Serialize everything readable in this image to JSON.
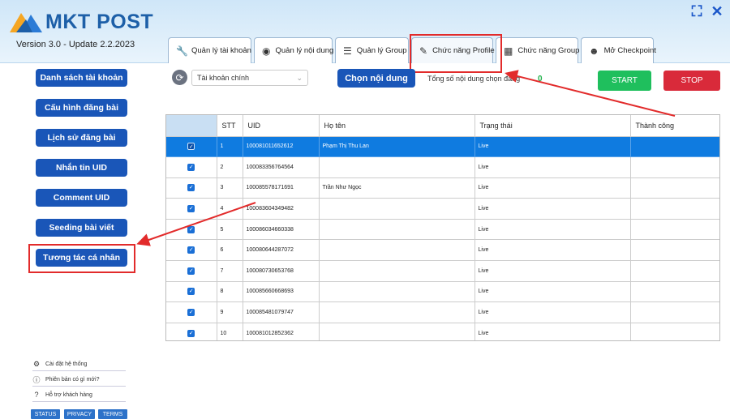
{
  "app": {
    "logo_text": "MKT POST",
    "version": "Version 3.0 - Update 2.2.2023"
  },
  "window": {
    "maximize_icon": "expand-icon",
    "close_icon": "close-icon"
  },
  "tabs": [
    {
      "label": "Quản lý tài khoản",
      "icon": "wrench-icon"
    },
    {
      "label": "Quản lý nội dung",
      "icon": "eye-icon"
    },
    {
      "label": "Quản lý Group",
      "icon": "list-icon"
    },
    {
      "label": "Chức năng Profile",
      "icon": "pencil-icon"
    },
    {
      "label": "Chức năng Group",
      "icon": "grid-icon"
    },
    {
      "label": "Mở Checkpoint",
      "icon": "user-icon"
    }
  ],
  "sidebar": {
    "items": [
      {
        "label": "Danh sách tài khoản"
      },
      {
        "label": "Cấu hình đăng bài"
      },
      {
        "label": "Lịch sử đăng bài"
      },
      {
        "label": "Nhắn tin UID"
      },
      {
        "label": "Comment UID"
      },
      {
        "label": "Seeding bài viết"
      },
      {
        "label": "Tương tác cá nhân"
      }
    ]
  },
  "footer": {
    "links": [
      {
        "label": "Cài đặt hệ thống",
        "icon": "gear-icon"
      },
      {
        "label": "Phiên bản có gì mới?",
        "icon": "info-icon"
      },
      {
        "label": "Hỗ trợ khách hàng",
        "icon": "help-icon"
      }
    ],
    "badges": [
      "STATUS",
      "PRIVACY",
      "TERMS"
    ]
  },
  "toolbar": {
    "account_select": "Tài khoản chính",
    "choose_content": "Chọn nội dung",
    "total_label": "Tổng số nội dung chọn đăng",
    "total_value": "0",
    "start": "START",
    "stop": "STOP"
  },
  "table": {
    "columns": [
      "",
      "STT",
      "UID",
      "Họ tên",
      "Trạng thái",
      "Thành công"
    ],
    "rows": [
      {
        "stt": "1",
        "uid": "100081011652612",
        "name": "Phạm Thị Thu Lan",
        "status": "Live",
        "success": ""
      },
      {
        "stt": "2",
        "uid": "100083356764564",
        "name": "",
        "status": "Live",
        "success": ""
      },
      {
        "stt": "3",
        "uid": "100085578171691",
        "name": "Trần Như Ngọc",
        "status": "Live",
        "success": ""
      },
      {
        "stt": "4",
        "uid": "100083604349482",
        "name": "",
        "status": "Live",
        "success": ""
      },
      {
        "stt": "5",
        "uid": "100086034660338",
        "name": "",
        "status": "Live",
        "success": ""
      },
      {
        "stt": "6",
        "uid": "100080644287072",
        "name": "",
        "status": "Live",
        "success": ""
      },
      {
        "stt": "7",
        "uid": "100080730653768",
        "name": "",
        "status": "Live",
        "success": ""
      },
      {
        "stt": "8",
        "uid": "100085660668693",
        "name": "",
        "status": "Live",
        "success": ""
      },
      {
        "stt": "9",
        "uid": "100085481079747",
        "name": "",
        "status": "Live",
        "success": ""
      },
      {
        "stt": "10",
        "uid": "100081012852362",
        "name": "",
        "status": "Live",
        "success": ""
      }
    ]
  },
  "colors": {
    "primary": "#1a56b8",
    "start": "#1fbf5d",
    "stop": "#d92a3a",
    "highlight": "#e22b2b",
    "selected_row": "#0f7be0"
  }
}
